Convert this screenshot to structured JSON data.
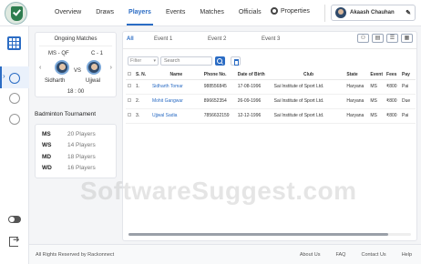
{
  "nav": {
    "items": [
      "Overview",
      "Draws",
      "Players",
      "Events",
      "Matches",
      "Officials"
    ],
    "active": "Players",
    "properties": "Properties",
    "user_name": "Akaash Chauhan"
  },
  "ongoing": {
    "title": "Ongoing Matches",
    "round": "MS - QF",
    "court": "C - 1",
    "vs": "VS",
    "player1": "Sidharth",
    "player2": "Ujjwal",
    "time": "18 : 00"
  },
  "tournament": {
    "title": "Badminton Tournament",
    "events": [
      {
        "code": "MS",
        "players": "20 Players"
      },
      {
        "code": "WS",
        "players": "14 Players"
      },
      {
        "code": "MD",
        "players": "18 Players"
      },
      {
        "code": "WD",
        "players": "16 Players"
      }
    ]
  },
  "tabs": [
    "All",
    "Event 1",
    "Event 2",
    "Event 3"
  ],
  "filter": {
    "label": "Filter",
    "search_placeholder": "Search"
  },
  "table": {
    "headers": [
      "S. N.",
      "Name",
      "Phone No.",
      "Date of Birth",
      "Club",
      "State",
      "Event",
      "Fees",
      "Pay"
    ],
    "rows": [
      [
        "1.",
        "Sidharth Tomar",
        "988556845",
        "17-08-1996",
        "Sai Institute of Sport Ltd.",
        "Haryana",
        "MS",
        "₹800",
        "Pai"
      ],
      [
        "2.",
        "Mohit Gangwar",
        "896652354",
        "26-09-1996",
        "Sai Institute of Sport Ltd.",
        "Haryana",
        "MS",
        "₹800",
        "Due"
      ],
      [
        "3.",
        "Ujjwal Sadia",
        "7856632159",
        "12-12-1996",
        "Sai Institute of Sport Ltd.",
        "Haryana",
        "MS",
        "₹800",
        "Pai"
      ]
    ]
  },
  "watermark": "SoftwareSuggest.com",
  "footer": {
    "copyright": "All Rights Reserved by Rackonnect",
    "links": [
      "About Us",
      "FAQ",
      "Contact Us",
      "Help"
    ]
  },
  "colors": {
    "accent": "#2b6cc4",
    "sidebar_active_bg": "#eaf1fb"
  },
  "icons": [
    "grid-icon",
    "gear-icon",
    "pencil-icon",
    "search-icon",
    "trash-icon",
    "toggle-icon",
    "logout-icon"
  ]
}
